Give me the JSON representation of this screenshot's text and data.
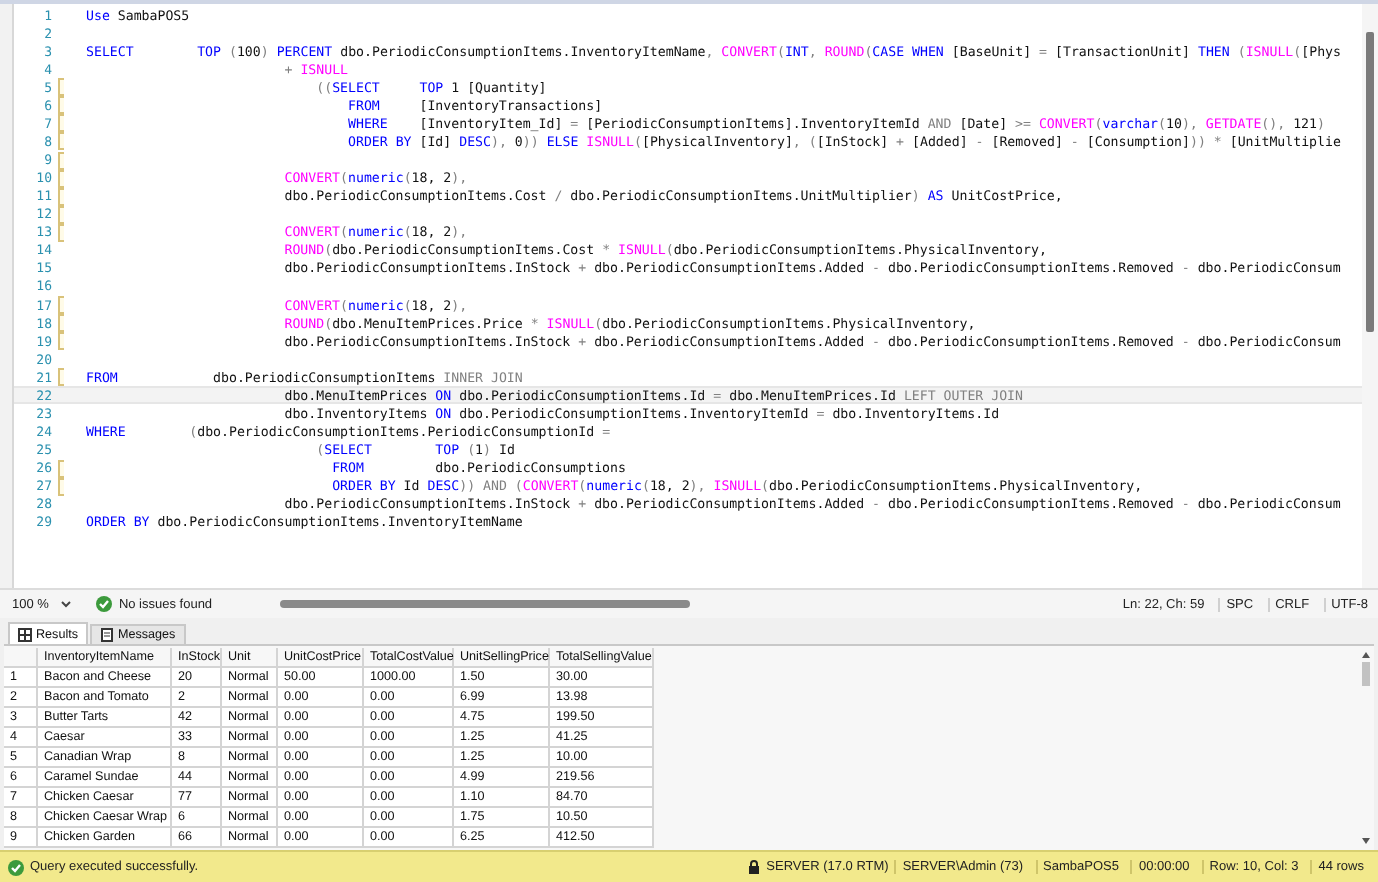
{
  "editor": {
    "lines": [
      {
        "number": "1",
        "changed": false,
        "current": false,
        "tokens": [
          {
            "kind": "keyword",
            "text": "Use "
          },
          {
            "kind": "plain",
            "text": "SambaPOS5"
          }
        ]
      },
      {
        "number": "2",
        "changed": false,
        "current": false
      },
      {
        "number": "3",
        "changed": false,
        "current": false,
        "tokens": [
          {
            "kind": "keyword",
            "text": "SELECT        "
          },
          {
            "kind": "keyword",
            "text": "TOP "
          },
          {
            "kind": "operator",
            "text": "("
          },
          {
            "kind": "plain",
            "text": "100"
          },
          {
            "kind": "operator",
            "text": ") "
          },
          {
            "kind": "keyword",
            "text": "PERCENT "
          },
          {
            "kind": "plain",
            "text": "dbo.PeriodicConsumptionItems.InventoryItemName"
          },
          {
            "kind": "operator",
            "text": ", "
          },
          {
            "kind": "function",
            "text": "CONVERT"
          },
          {
            "kind": "operator",
            "text": "("
          },
          {
            "kind": "keyword",
            "text": "INT"
          },
          {
            "kind": "operator",
            "text": ", "
          },
          {
            "kind": "function",
            "text": "ROUND"
          },
          {
            "kind": "operator",
            "text": "("
          },
          {
            "kind": "keyword",
            "text": "CASE WHEN "
          },
          {
            "kind": "plain",
            "text": "[BaseUnit] "
          },
          {
            "kind": "operator",
            "text": "= "
          },
          {
            "kind": "plain",
            "text": "[TransactionUnit] "
          },
          {
            "kind": "keyword",
            "text": "THEN "
          },
          {
            "kind": "operator",
            "text": "("
          },
          {
            "kind": "function",
            "text": "ISNULL"
          },
          {
            "kind": "operator",
            "text": "("
          },
          {
            "kind": "plain",
            "text": "[Phys"
          }
        ]
      },
      {
        "number": "4",
        "changed": false,
        "current": false,
        "tokens": [
          {
            "kind": "operator",
            "text": "                         + "
          },
          {
            "kind": "function",
            "text": "ISNULL"
          }
        ]
      },
      {
        "number": "5",
        "changed": true,
        "current": false,
        "tokens": [
          {
            "kind": "operator",
            "text": "                             (("
          },
          {
            "kind": "keyword",
            "text": "SELECT     "
          },
          {
            "kind": "keyword",
            "text": "TOP "
          },
          {
            "kind": "plain",
            "text": "1 [Quantity]"
          }
        ]
      },
      {
        "number": "6",
        "changed": true,
        "current": false,
        "tokens": [
          {
            "kind": "keyword",
            "text": "                                 FROM     "
          },
          {
            "kind": "plain",
            "text": "[InventoryTransactions]"
          }
        ]
      },
      {
        "number": "7",
        "changed": true,
        "current": false,
        "tokens": [
          {
            "kind": "keyword",
            "text": "                                 WHERE    "
          },
          {
            "kind": "plain",
            "text": "[InventoryItem_Id] "
          },
          {
            "kind": "operator",
            "text": "= "
          },
          {
            "kind": "plain",
            "text": "[PeriodicConsumptionItems].InventoryItemId "
          },
          {
            "kind": "operator",
            "text": "AND "
          },
          {
            "kind": "plain",
            "text": "[Date] "
          },
          {
            "kind": "operator",
            "text": ">= "
          },
          {
            "kind": "function",
            "text": "CONVERT"
          },
          {
            "kind": "operator",
            "text": "("
          },
          {
            "kind": "keyword",
            "text": "varchar"
          },
          {
            "kind": "operator",
            "text": "("
          },
          {
            "kind": "plain",
            "text": "10"
          },
          {
            "kind": "operator",
            "text": "), "
          },
          {
            "kind": "function",
            "text": "GETDATE"
          },
          {
            "kind": "operator",
            "text": "(), "
          },
          {
            "kind": "plain",
            "text": "121"
          },
          {
            "kind": "operator",
            "text": ")"
          }
        ]
      },
      {
        "number": "8",
        "changed": true,
        "current": false,
        "tokens": [
          {
            "kind": "keyword",
            "text": "                                 ORDER BY "
          },
          {
            "kind": "plain",
            "text": "[Id] "
          },
          {
            "kind": "keyword",
            "text": "DESC"
          },
          {
            "kind": "operator",
            "text": "), "
          },
          {
            "kind": "plain",
            "text": "0"
          },
          {
            "kind": "operator",
            "text": ")) "
          },
          {
            "kind": "keyword",
            "text": "ELSE "
          },
          {
            "kind": "function",
            "text": "ISNULL"
          },
          {
            "kind": "operator",
            "text": "("
          },
          {
            "kind": "plain",
            "text": "[PhysicalInventory]"
          },
          {
            "kind": "operator",
            "text": ", ("
          },
          {
            "kind": "plain",
            "text": "[InStock] "
          },
          {
            "kind": "operator",
            "text": "+ "
          },
          {
            "kind": "plain",
            "text": "[Added] "
          },
          {
            "kind": "operator",
            "text": "- "
          },
          {
            "kind": "plain",
            "text": "[Removed] "
          },
          {
            "kind": "operator",
            "text": "- "
          },
          {
            "kind": "plain",
            "text": "[Consumption]"
          },
          {
            "kind": "operator",
            "text": ")) * "
          },
          {
            "kind": "plain",
            "text": "[UnitMultiplie"
          }
        ]
      },
      {
        "number": "9",
        "changed": true,
        "current": false
      },
      {
        "number": "10",
        "changed": true,
        "current": false,
        "tokens": [
          {
            "kind": "function",
            "text": "                         CONVERT"
          },
          {
            "kind": "operator",
            "text": "("
          },
          {
            "kind": "keyword",
            "text": "numeric"
          },
          {
            "kind": "operator",
            "text": "("
          },
          {
            "kind": "plain",
            "text": "18, 2"
          },
          {
            "kind": "operator",
            "text": "),"
          }
        ]
      },
      {
        "number": "11",
        "changed": true,
        "current": false,
        "tokens": [
          {
            "kind": "plain",
            "text": "                         dbo.PeriodicConsumptionItems.Cost "
          },
          {
            "kind": "operator",
            "text": "/ "
          },
          {
            "kind": "plain",
            "text": "dbo.PeriodicConsumptionItems.UnitMultiplier"
          },
          {
            "kind": "operator",
            "text": ") "
          },
          {
            "kind": "keyword",
            "text": "AS "
          },
          {
            "kind": "plain",
            "text": "UnitCostPrice,"
          }
        ]
      },
      {
        "number": "12",
        "changed": true,
        "current": false
      },
      {
        "number": "13",
        "changed": true,
        "current": false,
        "tokens": [
          {
            "kind": "function",
            "text": "                         CONVERT"
          },
          {
            "kind": "operator",
            "text": "("
          },
          {
            "kind": "keyword",
            "text": "numeric"
          },
          {
            "kind": "operator",
            "text": "("
          },
          {
            "kind": "plain",
            "text": "18, 2"
          },
          {
            "kind": "operator",
            "text": "),"
          }
        ]
      },
      {
        "number": "14",
        "changed": false,
        "current": false,
        "tokens": [
          {
            "kind": "function",
            "text": "                         ROUND"
          },
          {
            "kind": "operator",
            "text": "("
          },
          {
            "kind": "plain",
            "text": "dbo.PeriodicConsumptionItems.Cost "
          },
          {
            "kind": "operator",
            "text": "* "
          },
          {
            "kind": "function",
            "text": "ISNULL"
          },
          {
            "kind": "operator",
            "text": "("
          },
          {
            "kind": "plain",
            "text": "dbo.PeriodicConsumptionItems.PhysicalInventory,"
          }
        ]
      },
      {
        "number": "15",
        "changed": false,
        "current": false,
        "tokens": [
          {
            "kind": "plain",
            "text": "                         dbo.PeriodicConsumptionItems.InStock "
          },
          {
            "kind": "operator",
            "text": "+ "
          },
          {
            "kind": "plain",
            "text": "dbo.PeriodicConsumptionItems.Added "
          },
          {
            "kind": "operator",
            "text": "- "
          },
          {
            "kind": "plain",
            "text": "dbo.PeriodicConsumptionItems.Removed "
          },
          {
            "kind": "operator",
            "text": "- "
          },
          {
            "kind": "plain",
            "text": "dbo.PeriodicConsum"
          }
        ]
      },
      {
        "number": "16",
        "changed": false,
        "current": false
      },
      {
        "number": "17",
        "changed": true,
        "current": false,
        "tokens": [
          {
            "kind": "function",
            "text": "                         CONVERT"
          },
          {
            "kind": "operator",
            "text": "("
          },
          {
            "kind": "keyword",
            "text": "numeric"
          },
          {
            "kind": "operator",
            "text": "("
          },
          {
            "kind": "plain",
            "text": "18, 2"
          },
          {
            "kind": "operator",
            "text": "),"
          }
        ]
      },
      {
        "number": "18",
        "changed": true,
        "current": false,
        "tokens": [
          {
            "kind": "function",
            "text": "                         ROUND"
          },
          {
            "kind": "operator",
            "text": "("
          },
          {
            "kind": "plain",
            "text": "dbo.MenuItemPrices.Price "
          },
          {
            "kind": "operator",
            "text": "* "
          },
          {
            "kind": "function",
            "text": "ISNULL"
          },
          {
            "kind": "operator",
            "text": "("
          },
          {
            "kind": "plain",
            "text": "dbo.PeriodicConsumptionItems.PhysicalInventory,"
          }
        ]
      },
      {
        "number": "19",
        "changed": true,
        "current": false,
        "tokens": [
          {
            "kind": "plain",
            "text": "                         dbo.PeriodicConsumptionItems.InStock "
          },
          {
            "kind": "operator",
            "text": "+ "
          },
          {
            "kind": "plain",
            "text": "dbo.PeriodicConsumptionItems.Added "
          },
          {
            "kind": "operator",
            "text": "- "
          },
          {
            "kind": "plain",
            "text": "dbo.PeriodicConsumptionItems.Removed "
          },
          {
            "kind": "operator",
            "text": "- "
          },
          {
            "kind": "plain",
            "text": "dbo.PeriodicConsum"
          }
        ]
      },
      {
        "number": "20",
        "changed": false,
        "current": false
      },
      {
        "number": "21",
        "changed": true,
        "current": false,
        "tokens": [
          {
            "kind": "keyword",
            "text": "FROM            "
          },
          {
            "kind": "plain",
            "text": "dbo.PeriodicConsumptionItems "
          },
          {
            "kind": "operator",
            "text": "INNER JOIN"
          }
        ]
      },
      {
        "number": "22",
        "changed": false,
        "current": true,
        "tokens": [
          {
            "kind": "plain",
            "text": "                         dbo.MenuItemPrices "
          },
          {
            "kind": "keyword",
            "text": "ON "
          },
          {
            "kind": "plain",
            "text": "dbo.PeriodicConsumptionItems.Id "
          },
          {
            "kind": "operator",
            "text": "= "
          },
          {
            "kind": "plain",
            "text": "dbo.MenuItemPrices.Id "
          },
          {
            "kind": "operator",
            "text": "LEFT OUTER JOIN"
          }
        ]
      },
      {
        "number": "23",
        "changed": false,
        "current": false,
        "tokens": [
          {
            "kind": "plain",
            "text": "                         dbo.InventoryItems "
          },
          {
            "kind": "keyword",
            "text": "ON "
          },
          {
            "kind": "plain",
            "text": "dbo.PeriodicConsumptionItems.InventoryItemId "
          },
          {
            "kind": "operator",
            "text": "= "
          },
          {
            "kind": "plain",
            "text": "dbo.InventoryItems.Id"
          }
        ]
      },
      {
        "number": "24",
        "changed": false,
        "current": false,
        "tokens": [
          {
            "kind": "keyword",
            "text": "WHERE        "
          },
          {
            "kind": "operator",
            "text": "("
          },
          {
            "kind": "plain",
            "text": "dbo.PeriodicConsumptionItems.PeriodicConsumptionId "
          },
          {
            "kind": "operator",
            "text": "="
          }
        ]
      },
      {
        "number": "25",
        "changed": false,
        "current": false,
        "tokens": [
          {
            "kind": "operator",
            "text": "                             ("
          },
          {
            "kind": "keyword",
            "text": "SELECT        "
          },
          {
            "kind": "keyword",
            "text": "TOP "
          },
          {
            "kind": "operator",
            "text": "("
          },
          {
            "kind": "plain",
            "text": "1"
          },
          {
            "kind": "operator",
            "text": ") "
          },
          {
            "kind": "plain",
            "text": "Id"
          }
        ]
      },
      {
        "number": "26",
        "changed": true,
        "current": false,
        "tokens": [
          {
            "kind": "keyword",
            "text": "                               FROM         "
          },
          {
            "kind": "plain",
            "text": "dbo.PeriodicConsumptions"
          }
        ]
      },
      {
        "number": "27",
        "changed": true,
        "current": false,
        "tokens": [
          {
            "kind": "keyword",
            "text": "                               ORDER BY "
          },
          {
            "kind": "plain",
            "text": "Id "
          },
          {
            "kind": "keyword",
            "text": "DESC"
          },
          {
            "kind": "operator",
            "text": ")) AND ("
          },
          {
            "kind": "function",
            "text": "CONVERT"
          },
          {
            "kind": "operator",
            "text": "("
          },
          {
            "kind": "keyword",
            "text": "numeric"
          },
          {
            "kind": "operator",
            "text": "("
          },
          {
            "kind": "plain",
            "text": "18, 2"
          },
          {
            "kind": "operator",
            "text": "), "
          },
          {
            "kind": "function",
            "text": "ISNULL"
          },
          {
            "kind": "operator",
            "text": "("
          },
          {
            "kind": "plain",
            "text": "dbo.PeriodicConsumptionItems.PhysicalInventory,"
          }
        ]
      },
      {
        "number": "28",
        "changed": false,
        "current": false,
        "tokens": [
          {
            "kind": "plain",
            "text": "                         dbo.PeriodicConsumptionItems.InStock "
          },
          {
            "kind": "operator",
            "text": "+ "
          },
          {
            "kind": "plain",
            "text": "dbo.PeriodicConsumptionItems.Added "
          },
          {
            "kind": "operator",
            "text": "- "
          },
          {
            "kind": "plain",
            "text": "dbo.PeriodicConsumptionItems.Removed "
          },
          {
            "kind": "operator",
            "text": "- "
          },
          {
            "kind": "plain",
            "text": "dbo.PeriodicConsum"
          }
        ]
      },
      {
        "number": "29",
        "changed": false,
        "current": false,
        "tokens": [
          {
            "kind": "keyword",
            "text": "ORDER BY "
          },
          {
            "kind": "plain",
            "text": "dbo.PeriodicConsumptionItems.InventoryItemName"
          }
        ]
      }
    ]
  },
  "editor_status": {
    "zoom": "100 %",
    "issues": "No issues found",
    "position": "Ln: 22, Ch: 59",
    "whitespace": "SPC",
    "line_ending": "CRLF",
    "encoding": "UTF-8"
  },
  "result_tabs": [
    {
      "label": "Results",
      "selected": true
    },
    {
      "label": "Messages",
      "selected": false
    }
  ],
  "results": {
    "columns": [
      "InventoryItemName",
      "InStock",
      "Unit",
      "UnitCostPrice",
      "TotalCostValue",
      "UnitSellingPrice",
      "TotalSellingValue"
    ],
    "rows": [
      {
        "number": "1",
        "cells": [
          "Bacon and Cheese",
          "20",
          "Normal",
          "50.00",
          "1000.00",
          "1.50",
          "30.00"
        ]
      },
      {
        "number": "2",
        "cells": [
          "Bacon and Tomato",
          "2",
          "Normal",
          "0.00",
          "0.00",
          "6.99",
          "13.98"
        ]
      },
      {
        "number": "3",
        "cells": [
          "Butter Tarts",
          "42",
          "Normal",
          "0.00",
          "0.00",
          "4.75",
          "199.50"
        ]
      },
      {
        "number": "4",
        "cells": [
          "Caesar",
          "33",
          "Normal",
          "0.00",
          "0.00",
          "1.25",
          "41.25"
        ]
      },
      {
        "number": "5",
        "cells": [
          "Canadian Wrap",
          "8",
          "Normal",
          "0.00",
          "0.00",
          "1.25",
          "10.00"
        ]
      },
      {
        "number": "6",
        "cells": [
          "Caramel Sundae",
          "44",
          "Normal",
          "0.00",
          "0.00",
          "4.99",
          "219.56"
        ]
      },
      {
        "number": "7",
        "cells": [
          "Chicken Caesar",
          "77",
          "Normal",
          "0.00",
          "0.00",
          "1.10",
          "84.70"
        ]
      },
      {
        "number": "8",
        "cells": [
          "Chicken Caesar Wrap",
          "6",
          "Normal",
          "0.00",
          "0.00",
          "1.75",
          "10.50"
        ]
      },
      {
        "number": "9",
        "cells": [
          "Chicken Garden",
          "66",
          "Normal",
          "0.00",
          "0.00",
          "6.25",
          "412.50"
        ]
      }
    ]
  },
  "status_bar": {
    "message": "Query executed successfully.",
    "server": "SERVER (17.0 RTM)",
    "user": "SERVER\\Admin (73)",
    "database": "SambaPOS5",
    "elapsed": "00:00:00",
    "cursor": "Row: 10, Col: 3",
    "row_count": "44 rows"
  }
}
